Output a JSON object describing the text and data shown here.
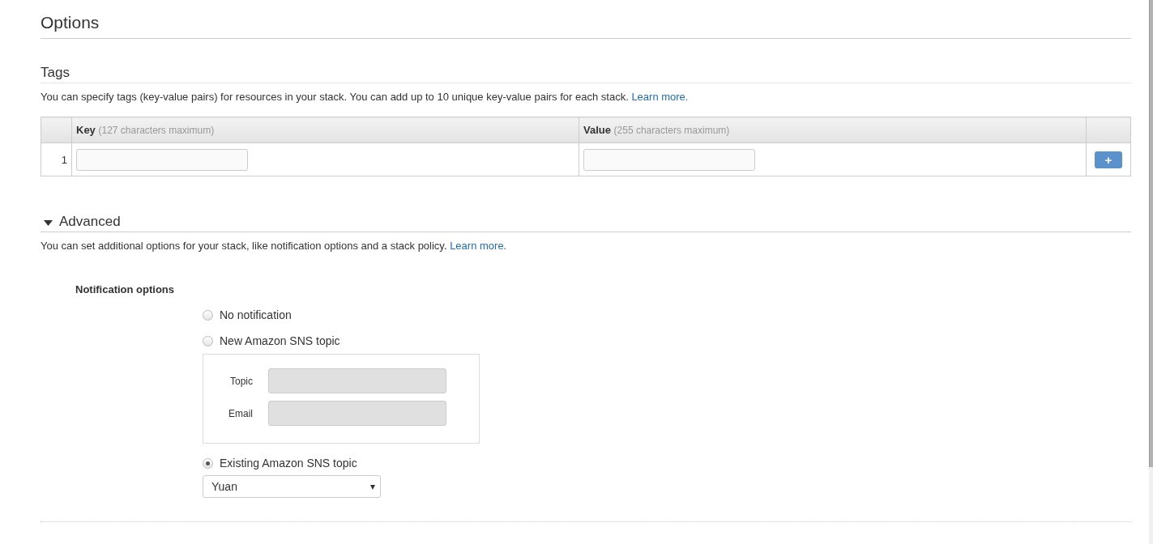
{
  "title": "Options",
  "tags": {
    "heading": "Tags",
    "description": "You can specify tags (key-value pairs) for resources in your stack. You can add up to 10 unique key-value pairs for each stack.",
    "link": "Learn more.",
    "columns": [
      {
        "label": "Key",
        "hint": "(127 characters maximum)"
      },
      {
        "label": "Value",
        "hint": "(255 characters maximum)"
      }
    ],
    "rows": [
      {
        "number": "1"
      }
    ],
    "add_button": "+"
  },
  "advanced": {
    "heading": "Advanced",
    "expanded": true,
    "description": "You can set additional options for your stack, like notification options and a stack policy.",
    "link": "Learn more.",
    "notification": {
      "label": "Notification options",
      "options": [
        {
          "label": "No notification",
          "selected": false
        },
        {
          "label": "New Amazon SNS topic",
          "selected": false,
          "fields": [
            {
              "label": "Topic",
              "disabled": true
            },
            {
              "label": "Email",
              "disabled": true
            }
          ]
        },
        {
          "label": "Existing Amazon SNS topic",
          "selected": true,
          "dropdown": {
            "value": "Yuan",
            "caret": "▾"
          }
        }
      ]
    }
  }
}
